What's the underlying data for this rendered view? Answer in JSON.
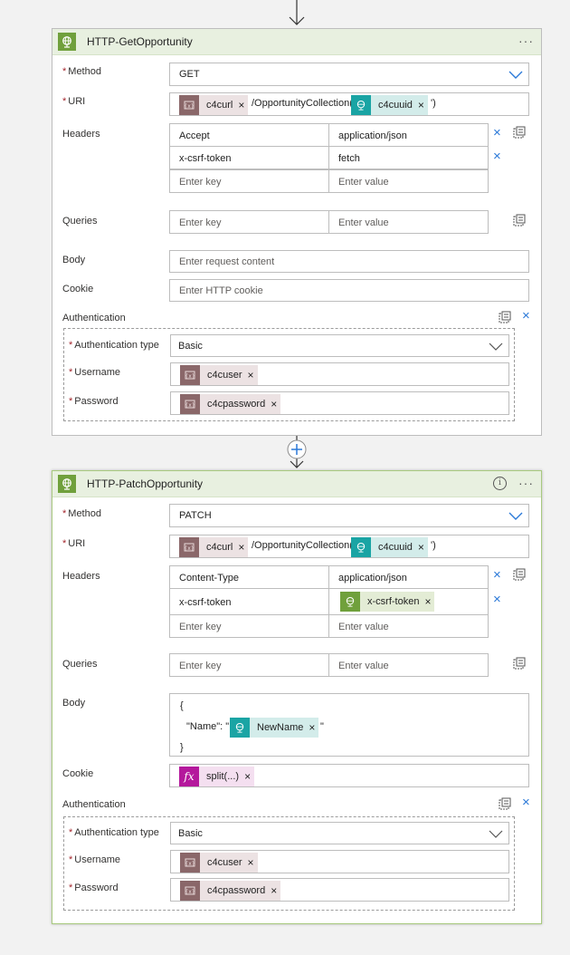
{
  "card1": {
    "title": "HTTP-GetOpportunity",
    "menu": "···",
    "method_label": "Method",
    "method_value": "GET",
    "uri_label": "URI",
    "uri_text1": "/OpportunityCollection('",
    "uri_text2": "')",
    "uri_token1": "c4curl",
    "uri_token2": "c4cuuid",
    "headers_label": "Headers",
    "headers": [
      {
        "key": "Accept",
        "value": "application/json"
      },
      {
        "key": "x-csrf-token",
        "value": "fetch"
      }
    ],
    "key_placeholder": "Enter key",
    "value_placeholder": "Enter value",
    "queries_label": "Queries",
    "body_label": "Body",
    "body_placeholder": "Enter request content",
    "cookie_label": "Cookie",
    "cookie_placeholder": "Enter HTTP cookie",
    "auth_label": "Authentication",
    "auth_type_label": "Authentication type",
    "auth_type_value": "Basic",
    "username_label": "Username",
    "username_token": "c4cuser",
    "password_label": "Password",
    "password_token": "c4cpassword"
  },
  "card2": {
    "title": "HTTP-PatchOpportunity",
    "menu": "···",
    "info": "i",
    "method_label": "Method",
    "method_value": "PATCH",
    "uri_label": "URI",
    "uri_text1": "/OpportunityCollection('",
    "uri_text2": "')",
    "uri_token1": "c4curl",
    "uri_token2": "c4cuuid",
    "headers_label": "Headers",
    "headers": [
      {
        "key": "Content-Type",
        "value": "application/json"
      },
      {
        "key": "x-csrf-token",
        "value_token": "x-csrf-token"
      }
    ],
    "key_placeholder": "Enter key",
    "value_placeholder": "Enter value",
    "queries_label": "Queries",
    "body_label": "Body",
    "body_line1": "{",
    "body_line2_prefix": "\"Name\": \"",
    "body_token": "NewName",
    "body_line2_suffix": "\"",
    "body_line3": "}",
    "cookie_label": "Cookie",
    "cookie_token": "split(...)",
    "cookie_token_icon": "fx",
    "auth_label": "Authentication",
    "auth_type_label": "Authentication type",
    "auth_type_value": "Basic",
    "username_label": "Username",
    "username_token": "c4cuser",
    "password_label": "Password",
    "password_token": "c4cpassword"
  },
  "required_mark": "*",
  "token_remove": "×",
  "colors": {
    "header_bg": "#e8f0e0",
    "http_icon": "#70a03c",
    "variable_token": "#8a6769",
    "http_token": "#1aa4a4",
    "fx_token": "#b4189c",
    "remove_blue": "#2b79d8"
  }
}
